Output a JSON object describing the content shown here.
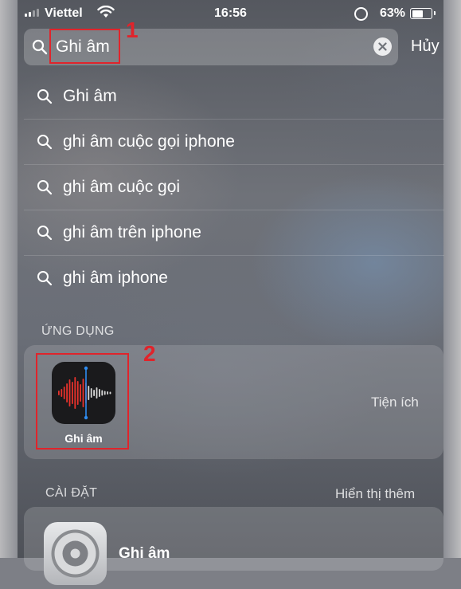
{
  "status_bar": {
    "carrier": "Viettel",
    "time": "16:56",
    "battery_percent": "63%",
    "battery_level": 0.63,
    "signal_bars": 2
  },
  "search": {
    "query": "Ghi âm",
    "cancel_label": "Hủy"
  },
  "annotations": {
    "marker_1": "1",
    "marker_2": "2"
  },
  "suggestions": [
    "Ghi âm",
    "ghi âm cuộc gọi iphone",
    "ghi âm cuộc gọi",
    "ghi âm trên iphone",
    "ghi âm iphone"
  ],
  "apps_section": {
    "label": "ỨNG DỤNG",
    "app_name": "Ghi âm",
    "app_category": "Tiện ích",
    "icon": "voice-memos-icon"
  },
  "settings_section": {
    "label": "CÀI ĐẶT",
    "more_label": "Hiển thị thêm",
    "item_title": "Ghi âm",
    "icon": "settings-gear-icon"
  },
  "colors": {
    "annotation_red": "#e0242b",
    "waveform_red": "#e8322c",
    "playhead_blue": "#2e8cf0"
  }
}
